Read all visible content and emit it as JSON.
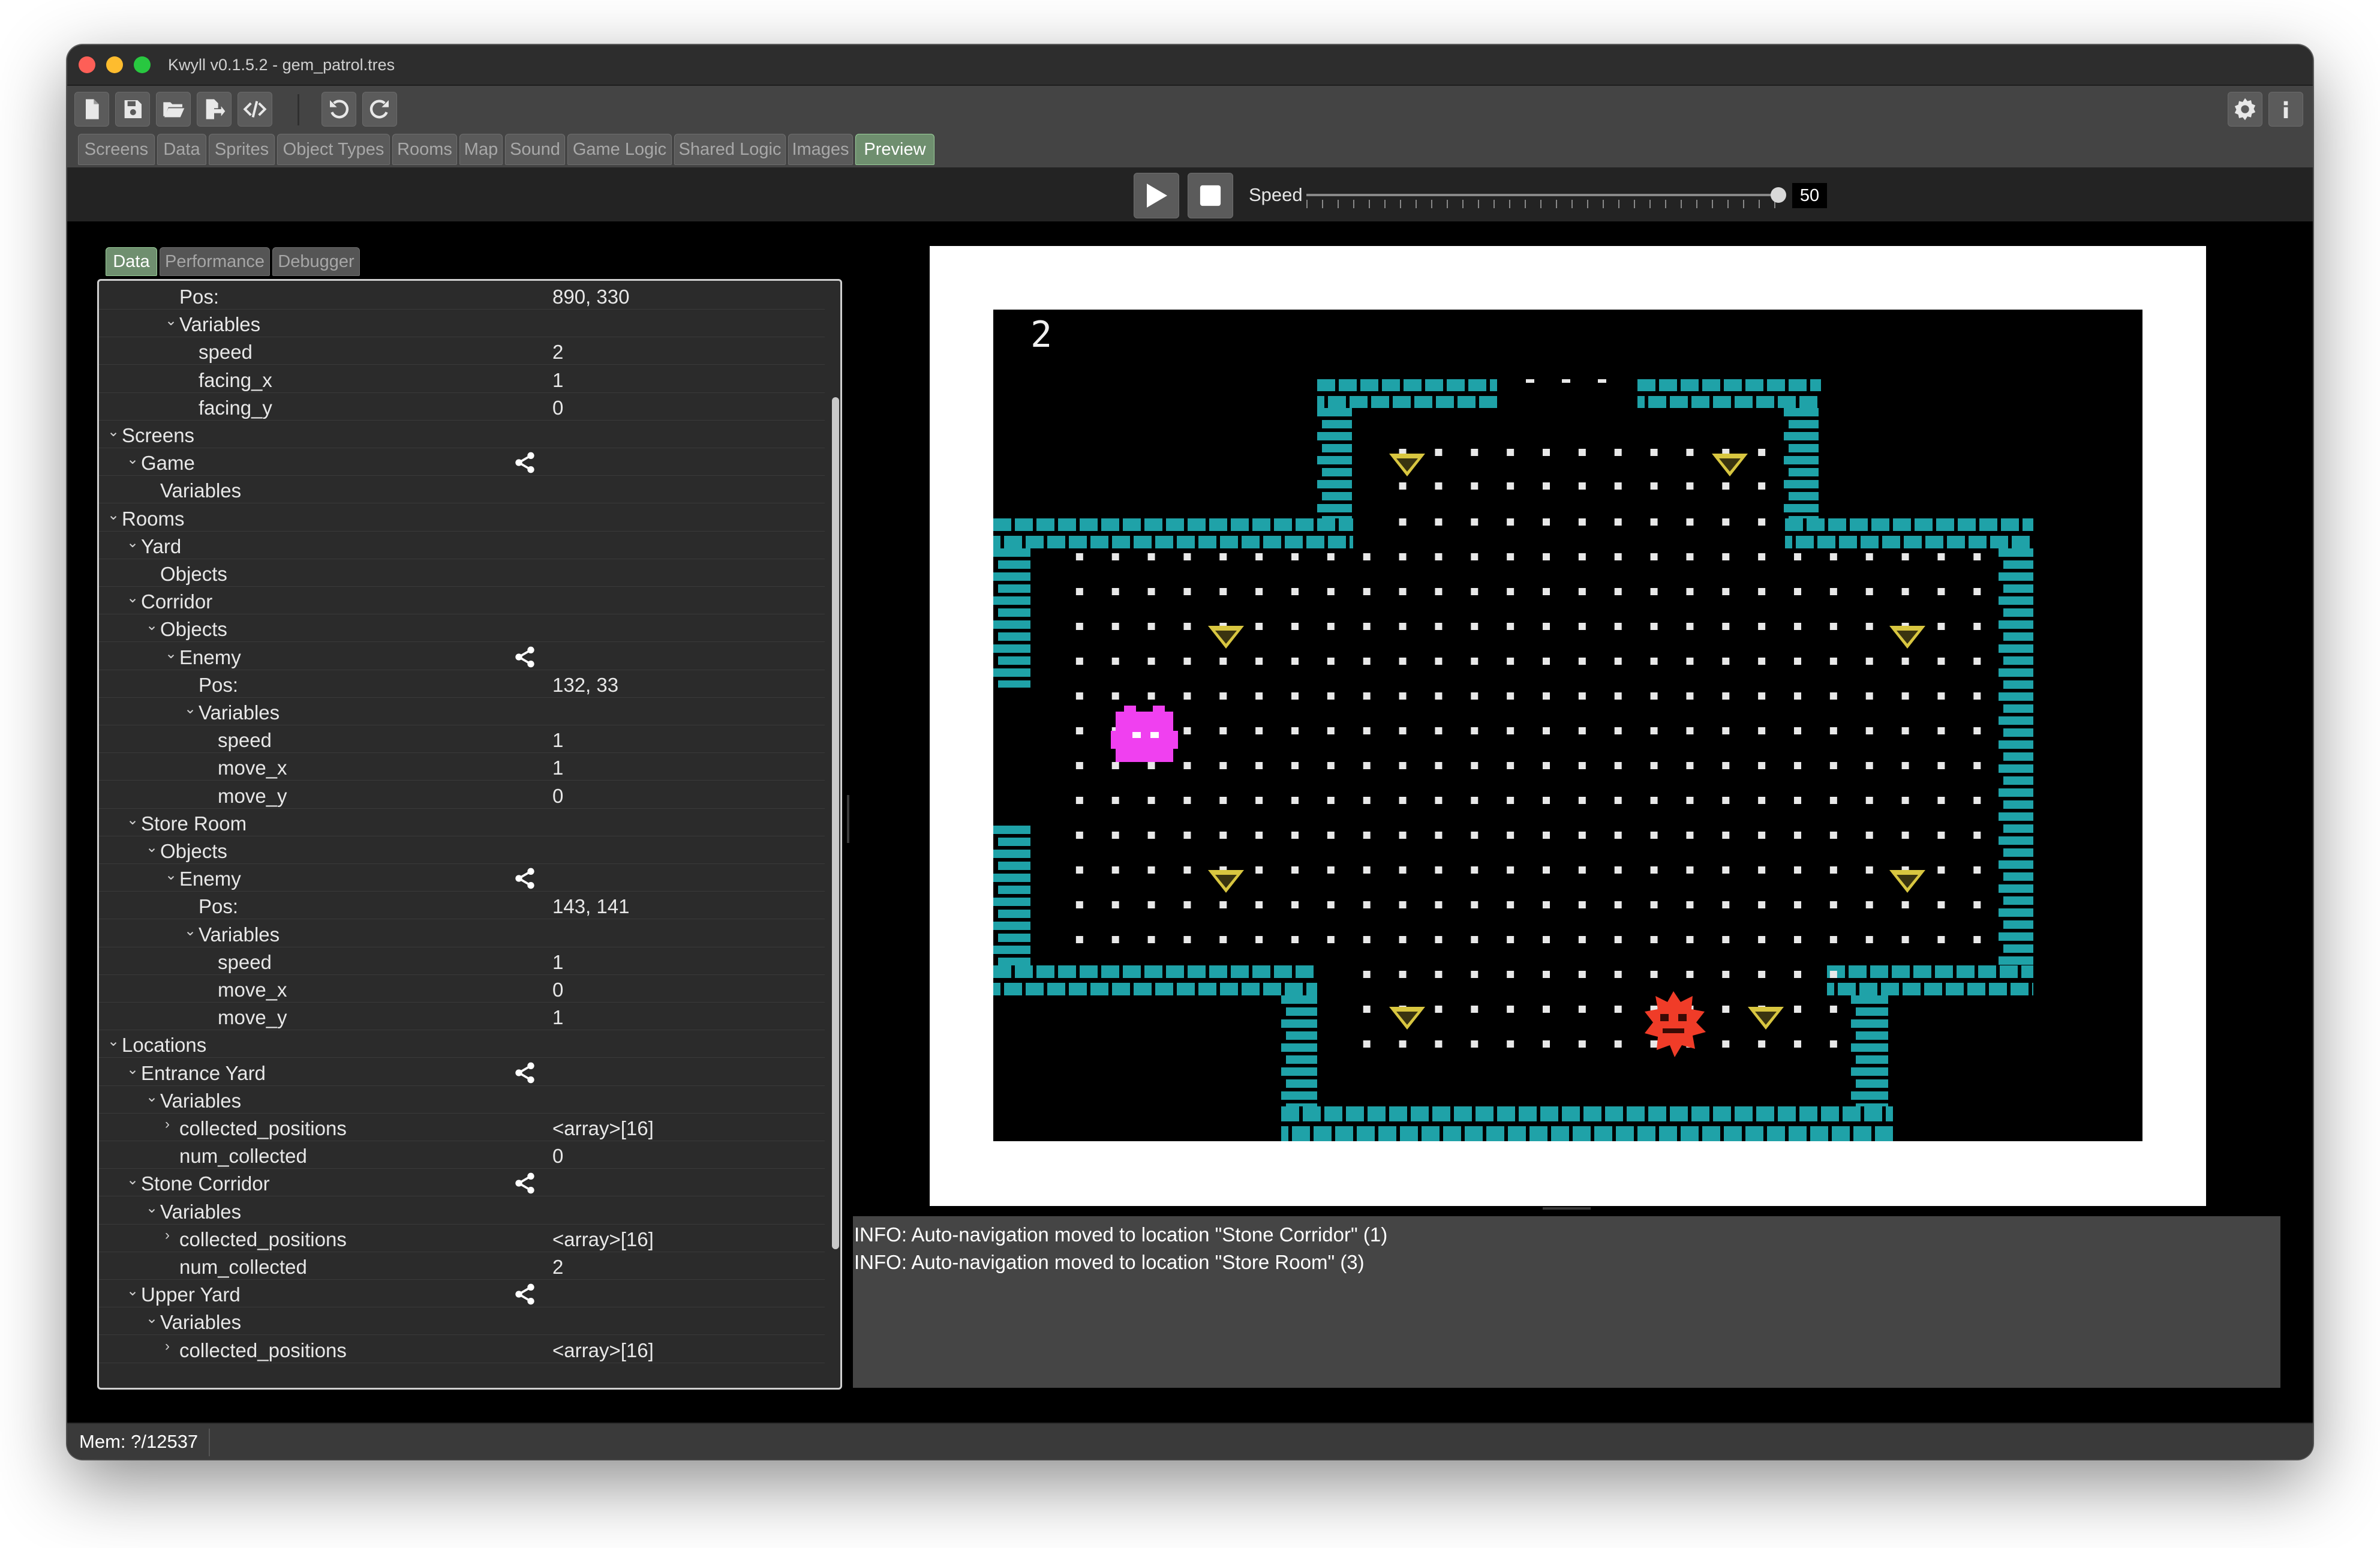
{
  "window": {
    "title": "Kwyll v0.1.5.2 - gem_patrol.tres"
  },
  "toolbar": {
    "buttons": [
      "new-file-icon",
      "save-icon",
      "open-folder-icon",
      "export-icon",
      "code-icon",
      "undo-icon",
      "redo-icon",
      "settings-icon",
      "info-icon"
    ]
  },
  "tabs": [
    "Screens",
    "Data",
    "Sprites",
    "Object Types",
    "Rooms",
    "Map",
    "Sound",
    "Game Logic",
    "Shared Logic",
    "Images",
    "Preview"
  ],
  "active_tab": "Preview",
  "preview_controls": {
    "play_icon": "play-icon",
    "stop_icon": "stop-icon",
    "speed_label": "Speed",
    "speed_value": "50",
    "speed_fraction": 0.5
  },
  "left_panel": {
    "tabs": [
      "Data",
      "Performance",
      "Debugger"
    ],
    "active_tab": "Data",
    "tree": [
      {
        "label": "Pos:",
        "value": "890, 330",
        "depth": 3,
        "expand": "",
        "share": false
      },
      {
        "label": "Variables",
        "value": "",
        "depth": 3,
        "expand": "open",
        "share": false
      },
      {
        "label": "speed",
        "value": "2",
        "depth": 4,
        "expand": "",
        "share": false
      },
      {
        "label": "facing_x",
        "value": "1",
        "depth": 4,
        "expand": "",
        "share": false
      },
      {
        "label": "facing_y",
        "value": "0",
        "depth": 4,
        "expand": "",
        "share": false
      },
      {
        "label": "Screens",
        "value": "",
        "depth": 0,
        "expand": "open",
        "share": false
      },
      {
        "label": "Game",
        "value": "",
        "depth": 1,
        "expand": "open",
        "share": true
      },
      {
        "label": "Variables",
        "value": "",
        "depth": 2,
        "expand": "",
        "share": false
      },
      {
        "label": "Rooms",
        "value": "",
        "depth": 0,
        "expand": "open",
        "share": false
      },
      {
        "label": "Yard",
        "value": "",
        "depth": 1,
        "expand": "open",
        "share": false
      },
      {
        "label": "Objects",
        "value": "",
        "depth": 2,
        "expand": "",
        "share": false
      },
      {
        "label": "Corridor",
        "value": "",
        "depth": 1,
        "expand": "open",
        "share": false
      },
      {
        "label": "Objects",
        "value": "",
        "depth": 2,
        "expand": "open",
        "share": false
      },
      {
        "label": "Enemy",
        "value": "",
        "depth": 3,
        "expand": "open",
        "share": true
      },
      {
        "label": "Pos:",
        "value": "132, 33",
        "depth": 4,
        "expand": "",
        "share": false
      },
      {
        "label": "Variables",
        "value": "",
        "depth": 4,
        "expand": "open",
        "share": false
      },
      {
        "label": "speed",
        "value": "1",
        "depth": 5,
        "expand": "",
        "share": false
      },
      {
        "label": "move_x",
        "value": "1",
        "depth": 5,
        "expand": "",
        "share": false
      },
      {
        "label": "move_y",
        "value": "0",
        "depth": 5,
        "expand": "",
        "share": false
      },
      {
        "label": "Store Room",
        "value": "",
        "depth": 1,
        "expand": "open",
        "share": false
      },
      {
        "label": "Objects",
        "value": "",
        "depth": 2,
        "expand": "open",
        "share": false
      },
      {
        "label": "Enemy",
        "value": "",
        "depth": 3,
        "expand": "open",
        "share": true
      },
      {
        "label": "Pos:",
        "value": "143, 141",
        "depth": 4,
        "expand": "",
        "share": false
      },
      {
        "label": "Variables",
        "value": "",
        "depth": 4,
        "expand": "open",
        "share": false
      },
      {
        "label": "speed",
        "value": "1",
        "depth": 5,
        "expand": "",
        "share": false
      },
      {
        "label": "move_x",
        "value": "0",
        "depth": 5,
        "expand": "",
        "share": false
      },
      {
        "label": "move_y",
        "value": "1",
        "depth": 5,
        "expand": "",
        "share": false
      },
      {
        "label": "Locations",
        "value": "",
        "depth": 0,
        "expand": "open",
        "share": false
      },
      {
        "label": "Entrance Yard",
        "value": "",
        "depth": 1,
        "expand": "open",
        "share": true
      },
      {
        "label": "Variables",
        "value": "",
        "depth": 2,
        "expand": "open",
        "share": false
      },
      {
        "label": "collected_positions",
        "value": "<array>[16]",
        "depth": 3,
        "expand": "closed",
        "share": false
      },
      {
        "label": "num_collected",
        "value": "0",
        "depth": 3,
        "expand": "",
        "share": false
      },
      {
        "label": "Stone Corridor",
        "value": "",
        "depth": 1,
        "expand": "open",
        "share": true
      },
      {
        "label": "Variables",
        "value": "",
        "depth": 2,
        "expand": "open",
        "share": false
      },
      {
        "label": "collected_positions",
        "value": "<array>[16]",
        "depth": 3,
        "expand": "closed",
        "share": false
      },
      {
        "label": "num_collected",
        "value": "2",
        "depth": 3,
        "expand": "",
        "share": false
      },
      {
        "label": "Upper Yard",
        "value": "",
        "depth": 1,
        "expand": "open",
        "share": true
      },
      {
        "label": "Variables",
        "value": "",
        "depth": 2,
        "expand": "open",
        "share": false
      },
      {
        "label": "collected_positions",
        "value": "<array>[16]",
        "depth": 3,
        "expand": "closed",
        "share": false
      }
    ]
  },
  "game_preview": {
    "hud_counter": "2",
    "colors": {
      "wall": "#1fa2a8",
      "dot": "#e8e8e8",
      "gem": "#d8c640",
      "player": "#f040f0",
      "enemy": "#f03c28"
    }
  },
  "console": {
    "lines": [
      "INFO: Auto-navigation moved to location \"Stone Corridor\" (1)",
      "INFO: Auto-navigation moved to location \"Store Room\" (3)"
    ]
  },
  "status_bar": {
    "memory": "Mem: ?/12537"
  }
}
